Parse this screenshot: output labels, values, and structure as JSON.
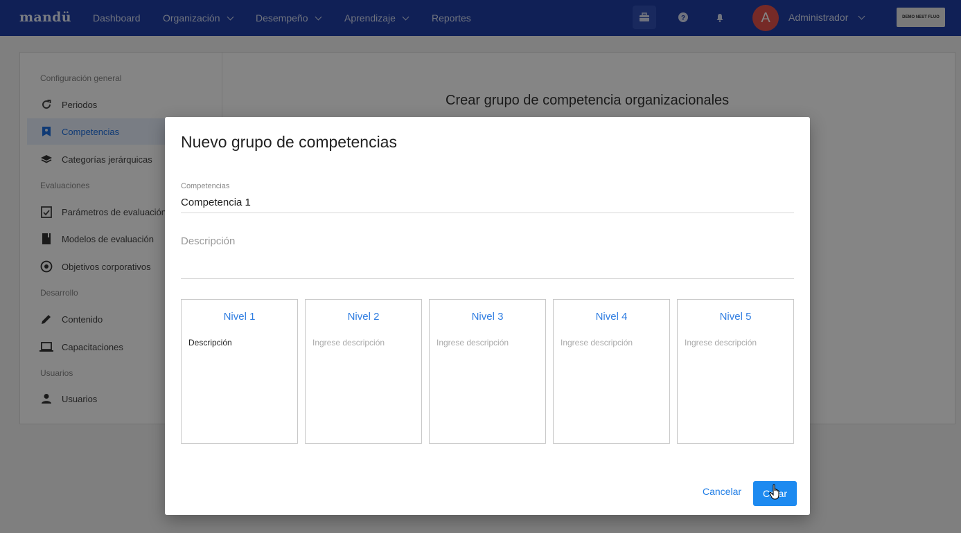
{
  "nav": {
    "logo": "mandü",
    "items": [
      {
        "label": "Dashboard",
        "dropdown": false
      },
      {
        "label": "Organización",
        "dropdown": true
      },
      {
        "label": "Desempeño",
        "dropdown": true
      },
      {
        "label": "Aprendizaje",
        "dropdown": true
      },
      {
        "label": "Reportes",
        "dropdown": false
      }
    ],
    "icons": [
      "briefcase-icon",
      "help-icon",
      "bell-icon"
    ],
    "user_initial": "A",
    "user_name": "Administrador",
    "company_logo_text": "DEMO NEST FLUO"
  },
  "sidebar": {
    "sections": [
      {
        "title": "Configuración general",
        "items": [
          {
            "label": "Periodos",
            "icon": "refresh-icon"
          },
          {
            "label": "Competencias",
            "icon": "bookmark-icon",
            "selected": true
          },
          {
            "label": "Categorías jerárquicas",
            "icon": "layers-icon"
          }
        ]
      },
      {
        "title": "Evaluaciones",
        "items": [
          {
            "label": "Parámetros de evaluación",
            "icon": "checkbox-icon"
          },
          {
            "label": "Modelos de evaluación",
            "icon": "book-icon"
          },
          {
            "label": "Objetivos corporativos",
            "icon": "target-icon"
          }
        ]
      },
      {
        "title": "Desarrollo",
        "items": [
          {
            "label": "Contenido",
            "icon": "pencil-icon"
          },
          {
            "label": "Capacitaciones",
            "icon": "laptop-icon"
          }
        ]
      },
      {
        "title": "Usuarios",
        "items": [
          {
            "label": "Usuarios",
            "icon": "person-icon"
          }
        ]
      }
    ]
  },
  "background_heading": "Crear grupo de competencia organizacionales",
  "modal": {
    "title": "Nuevo grupo de competencias",
    "competencias_label": "Competencias",
    "competencias_value": "Competencia 1",
    "descripcion_placeholder": "Descripción",
    "levels": [
      {
        "title": "Nivel 1",
        "description": "Descripción",
        "filled": true
      },
      {
        "title": "Nivel 2",
        "description": "Ingrese descripción",
        "filled": false
      },
      {
        "title": "Nivel 3",
        "description": "Ingrese descripción",
        "filled": false
      },
      {
        "title": "Nivel 4",
        "description": "Ingrese descripción",
        "filled": false
      },
      {
        "title": "Nivel 5",
        "description": "Ingrese descripción",
        "filled": false
      }
    ],
    "cancel_label": "Cancelar",
    "create_label": "Crear"
  },
  "colors": {
    "navbar": "#1f3fa6",
    "accent": "#1d8af0",
    "level_title": "#2f7de1",
    "avatar": "#e3524c"
  }
}
